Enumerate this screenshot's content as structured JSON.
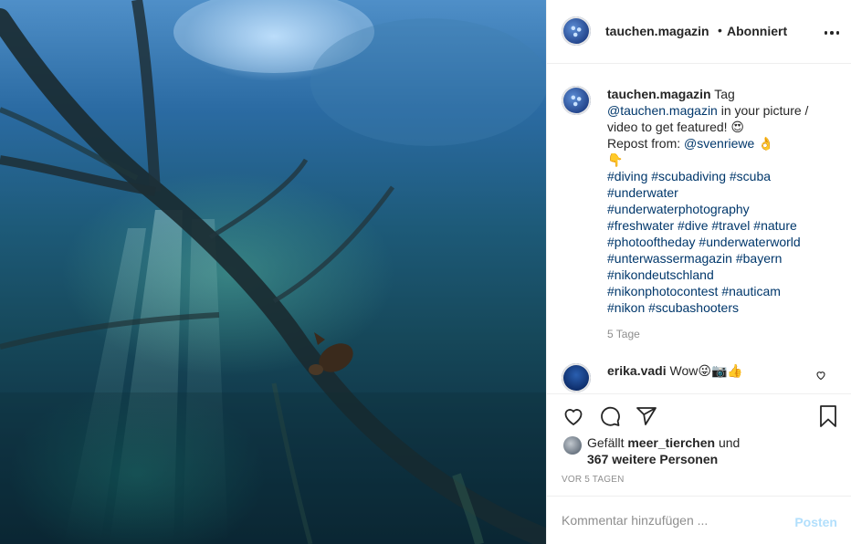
{
  "post": {
    "account": "tauchen.magazin",
    "separator": "•",
    "follow_state": "Abonniert"
  },
  "caption": {
    "username": "tauchen.magazin",
    "text_tag": "Tag",
    "mention_self": "@tauchen.magazin",
    "text_rest": "in your picture /",
    "text_line2": "video to get featured! 😍",
    "repost_label": "Repost from:",
    "mention_repost": "@svenriewe",
    "emoji_ok": "👌",
    "emoji_down": "👇",
    "hashtag_lines": [
      "#diving #scubadiving #scuba",
      "#underwater",
      "#underwaterphotography",
      "#freshwater #dive #travel #nature",
      "#photooftheday #underwaterworld",
      "#unterwassermagazin #bayern",
      "#nikondeutschland",
      "#nikonphotocontest #nauticam",
      "#nikon #scubashooters"
    ],
    "age": "5 Tage"
  },
  "comments": [
    {
      "username": "erika.vadi",
      "text": "Wow😜📷👍"
    }
  ],
  "likes": {
    "prefix": "Gefällt",
    "user": "meer_tierchen",
    "middle": "und",
    "others": "367 weitere Personen"
  },
  "posted_ago": "VOR 5 TAGEN",
  "comment_box": {
    "placeholder": "Kommentar hinzufügen ...",
    "post_label": "Posten"
  },
  "icons": {
    "more": "more-horizontal-icon",
    "like": "heart-icon",
    "comment": "comment-icon",
    "share": "paper-plane-icon",
    "save": "bookmark-icon"
  },
  "colors": {
    "link": "#00376b",
    "muted": "#8e8e8e",
    "post_disabled": "#b2dffc",
    "text": "#262626"
  }
}
